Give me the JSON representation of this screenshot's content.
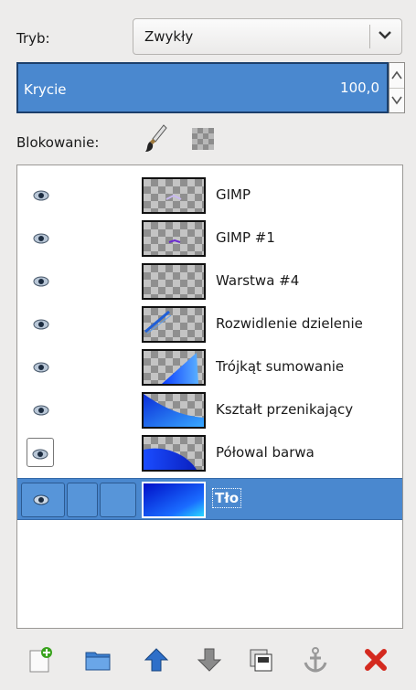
{
  "mode": {
    "label": "Tryb:",
    "value": "Zwykły"
  },
  "opacity": {
    "label": "Krycie",
    "value": "100,0"
  },
  "lock": {
    "label": "Blokowanie:",
    "icons": [
      "paintbrush-icon",
      "alpha-checker-icon"
    ]
  },
  "layers": [
    {
      "name": "GIMP",
      "visible": true,
      "selected": false
    },
    {
      "name": "GIMP #1",
      "visible": true,
      "selected": false
    },
    {
      "name": "Warstwa #4",
      "visible": true,
      "selected": false
    },
    {
      "name": "Rozwidlenie dzielenie",
      "visible": true,
      "selected": false
    },
    {
      "name": "Trójkąt sumowanie",
      "visible": true,
      "selected": false
    },
    {
      "name": "Kształt przenikający",
      "visible": true,
      "selected": false
    },
    {
      "name": "Półowal barwa",
      "visible": true,
      "selected": false
    },
    {
      "name": "Tło",
      "visible": true,
      "selected": true
    }
  ],
  "toolbar": {
    "icons": [
      "new-layer-icon",
      "new-group-icon",
      "raise-layer-icon",
      "lower-layer-icon",
      "duplicate-layer-icon",
      "anchor-layer-icon",
      "delete-layer-icon"
    ]
  },
  "colors": {
    "selection": "#4a88cf",
    "delete": "#d42a1f",
    "arrows": "#2e6fc9"
  }
}
